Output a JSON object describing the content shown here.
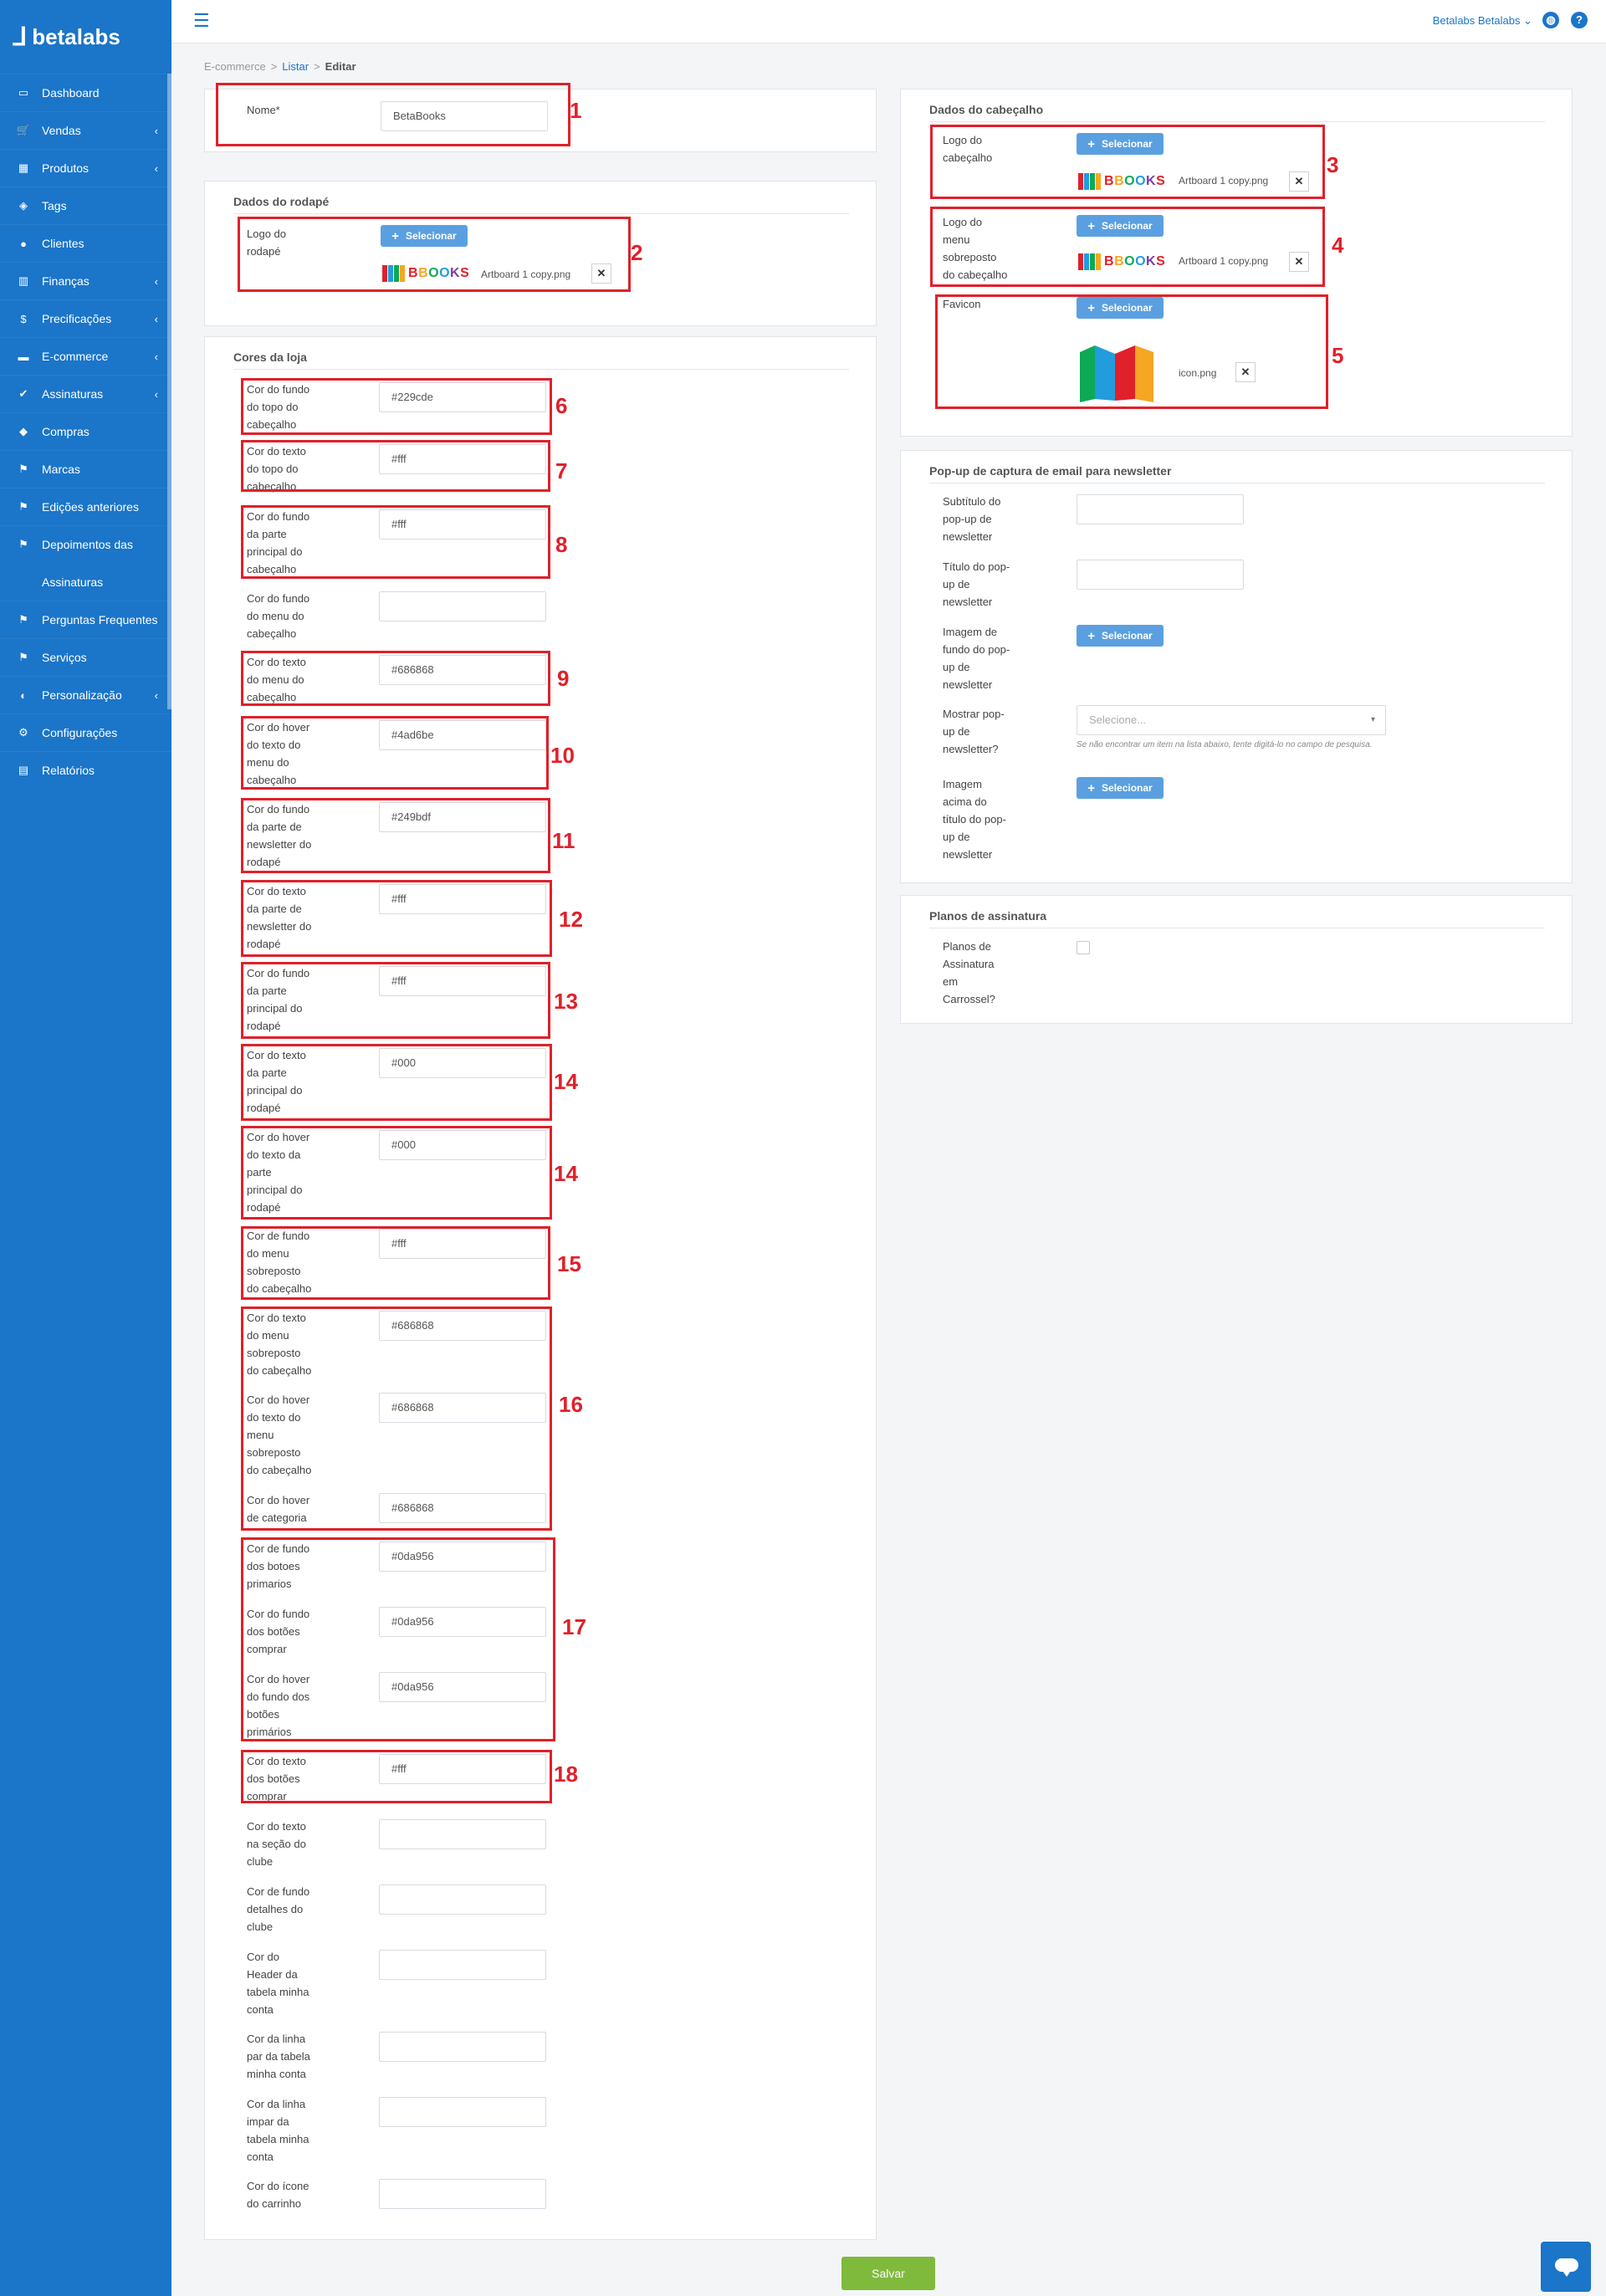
{
  "app": {
    "brand": "betalabs",
    "accent": "#1b75c9",
    "annotation_color": "#e0202a"
  },
  "topbar": {
    "user": "Betalabs Betalabs",
    "globe_icon": "globe-icon",
    "help_icon": "help-icon",
    "help_glyph": "?"
  },
  "breadcrumb": {
    "root": "E-commerce",
    "list": "Listar",
    "current": "Editar",
    "sep": ">"
  },
  "sidebar": {
    "items": [
      {
        "label": "Dashboard",
        "icon": "monitor-icon",
        "glyph": "▭",
        "chevron": false
      },
      {
        "label": "Vendas",
        "icon": "cart-icon",
        "glyph": "🛒",
        "chevron": true
      },
      {
        "label": "Produtos",
        "icon": "grid-icon",
        "glyph": "▦",
        "chevron": true
      },
      {
        "label": "Tags",
        "icon": "tag-icon",
        "glyph": "◈",
        "chevron": false
      },
      {
        "label": "Clientes",
        "icon": "user-icon",
        "glyph": "●",
        "chevron": false
      },
      {
        "label": "Finanças",
        "icon": "bar-chart-icon",
        "glyph": "▥",
        "chevron": true
      },
      {
        "label": "Precificações",
        "icon": "dollar-icon",
        "glyph": "$",
        "chevron": true
      },
      {
        "label": "E-commerce",
        "icon": "card-icon",
        "glyph": "▬",
        "chevron": true
      },
      {
        "label": "Assinaturas",
        "icon": "check-icon",
        "glyph": "✔",
        "chevron": true
      },
      {
        "label": "Compras",
        "icon": "tag2-icon",
        "glyph": "◆",
        "chevron": false
      },
      {
        "label": "Marcas",
        "icon": "flag-icon",
        "glyph": "⚑",
        "chevron": false
      },
      {
        "label": "Edições anteriores",
        "icon": "flag-icon",
        "glyph": "⚑",
        "chevron": false
      },
      {
        "label": "Depoimentos das",
        "icon": "flag-icon",
        "glyph": "⚑",
        "chevron": false
      },
      {
        "label": "Assinaturas",
        "icon": "",
        "glyph": "",
        "chevron": false
      },
      {
        "label": "Perguntas Frequentes",
        "icon": "flag-icon",
        "glyph": "⚑",
        "chevron": false
      },
      {
        "label": "Serviços",
        "icon": "flag-icon",
        "glyph": "⚑",
        "chevron": false
      },
      {
        "label": "Personalização",
        "icon": "contrast-icon",
        "glyph": "◐",
        "chevron": true
      },
      {
        "label": "Configurações",
        "icon": "gear-icon",
        "glyph": "⚙",
        "chevron": false
      },
      {
        "label": "Relatórios",
        "icon": "report-icon",
        "glyph": "▤",
        "chevron": false
      }
    ],
    "chevron_glyph": "‹"
  },
  "nome": {
    "label": "Nome*",
    "value": "BetaBooks"
  },
  "rodape": {
    "title": "Dados do rodapé",
    "logo_label": [
      "Logo do",
      "rodapé"
    ],
    "select_label": "Selecionar",
    "file": "Artboard 1 copy.png",
    "logo_text": "BBOOKS"
  },
  "cabecalho": {
    "title": "Dados do cabeçalho",
    "logo_label": [
      "Logo do",
      "cabeçalho"
    ],
    "logo_file": "Artboard 1 copy.png",
    "menu_logo_label": [
      "Logo do",
      "menu",
      "sobreposto",
      "do cabeçalho"
    ],
    "menu_logo_file": "Artboard 1 copy.png",
    "favicon_label": "Favicon",
    "favicon_file": "icon.png",
    "select_label": "Selecionar",
    "logo_text": "BBOOKS"
  },
  "cores": {
    "title": "Cores da loja",
    "fields": [
      {
        "label": [
          "Cor do fundo",
          "do topo do",
          "cabeçalho"
        ],
        "value": "#229cde"
      },
      {
        "label": [
          "Cor do texto",
          "do topo do",
          "cabeçalho"
        ],
        "value": "#fff"
      },
      {
        "label": [
          "Cor do fundo",
          "da parte",
          "principal do",
          "cabeçalho"
        ],
        "value": "#fff"
      },
      {
        "label": [
          "Cor do fundo",
          "do menu do",
          "cabeçalho"
        ],
        "value": ""
      },
      {
        "label": [
          "Cor do texto",
          "do menu do",
          "cabeçalho"
        ],
        "value": "#686868"
      },
      {
        "label": [
          "Cor do hover",
          "do texto do",
          "menu do",
          "cabeçalho"
        ],
        "value": "#4ad6be"
      },
      {
        "label": [
          "Cor do fundo",
          "da parte de",
          "newsletter do",
          "rodapé"
        ],
        "value": "#249bdf"
      },
      {
        "label": [
          "Cor do texto",
          "da parte de",
          "newsletter do",
          "rodapé"
        ],
        "value": "#fff"
      },
      {
        "label": [
          "Cor do fundo",
          "da parte",
          "principal do",
          "rodapé"
        ],
        "value": "#fff"
      },
      {
        "label": [
          "Cor do texto",
          "da parte",
          "principal do",
          "rodapé"
        ],
        "value": "#000"
      },
      {
        "label": [
          "Cor do hover",
          "do texto da",
          "parte",
          "principal do",
          "rodapé"
        ],
        "value": "#000"
      },
      {
        "label": [
          "Cor de fundo",
          "do menu",
          "sobreposto",
          "do cabeçalho"
        ],
        "value": "#fff"
      },
      {
        "label": [
          "Cor do texto",
          "do menu",
          "sobreposto",
          "do cabeçalho"
        ],
        "value": "#686868"
      },
      {
        "label": [
          "Cor do hover",
          "do texto do",
          "menu",
          "sobreposto",
          "do cabeçalho"
        ],
        "value": "#686868"
      },
      {
        "label": [
          "Cor do hover",
          "de categoria"
        ],
        "value": "#686868"
      },
      {
        "label": [
          "Cor de fundo",
          "dos botoes",
          "primarios"
        ],
        "value": "#0da956"
      },
      {
        "label": [
          "Cor do fundo",
          "dos botões",
          "comprar"
        ],
        "value": "#0da956"
      },
      {
        "label": [
          "Cor do hover",
          "do fundo dos",
          "botões",
          "primários"
        ],
        "value": "#0da956"
      },
      {
        "label": [
          "Cor do texto",
          "dos botões",
          "comprar"
        ],
        "value": "#fff"
      },
      {
        "label": [
          "Cor do texto",
          "na seção do",
          "clube"
        ],
        "value": ""
      },
      {
        "label": [
          "Cor de fundo",
          "detalhes do",
          "clube"
        ],
        "value": ""
      },
      {
        "label": [
          "Cor do",
          "Header da",
          "tabela minha",
          "conta"
        ],
        "value": ""
      },
      {
        "label": [
          "Cor da linha",
          "par da tabela",
          "minha conta"
        ],
        "value": ""
      },
      {
        "label": [
          "Cor da linha",
          "impar da",
          "tabela minha",
          "conta"
        ],
        "value": ""
      },
      {
        "label": [
          "Cor do ícone",
          "do carrinho"
        ],
        "value": ""
      }
    ]
  },
  "newsletter": {
    "title": "Pop-up de captura de email para newsletter",
    "subtitle_label": [
      "Subtítulo do",
      "pop-up de",
      "newsletter"
    ],
    "title_label": [
      "Título do pop-",
      "up de",
      "newsletter"
    ],
    "bg_label": [
      "Imagem de",
      "fundo do pop-",
      "up de",
      "newsletter"
    ],
    "show_label": [
      "Mostrar pop-",
      "up de",
      "newsletter?"
    ],
    "show_placeholder": "Selecione...",
    "show_hint": "Se não encontrar um item na lista abaixo, tente digitá-lo no campo de pesquisa.",
    "above_label": [
      "Imagem",
      "acima do",
      "título do pop-",
      "up de",
      "newsletter"
    ],
    "select_label": "Selecionar"
  },
  "planos": {
    "title": "Planos de assinatura",
    "carousel_label": [
      "Planos de",
      "Assinatura",
      "em",
      "Carrossel?"
    ],
    "carousel_checked": false
  },
  "annotations": [
    "1",
    "2",
    "3",
    "4",
    "5",
    "6",
    "7",
    "8",
    "9",
    "10",
    "11",
    "12",
    "13",
    "14",
    "14",
    "15",
    "16",
    "17",
    "18"
  ],
  "actions": {
    "save_label": "Salvar",
    "save_color": "#7fba3c",
    "chat_icon": "chat-icon"
  },
  "logo_colors": {
    "b1": "#e0202a",
    "b2": "#229cde",
    "b3": "#0da956",
    "b4": "#f5a623",
    "text": [
      "#e0202a",
      "#f5a623",
      "#0da956",
      "#229cde",
      "#7b3fa0",
      "#e0202a"
    ]
  }
}
